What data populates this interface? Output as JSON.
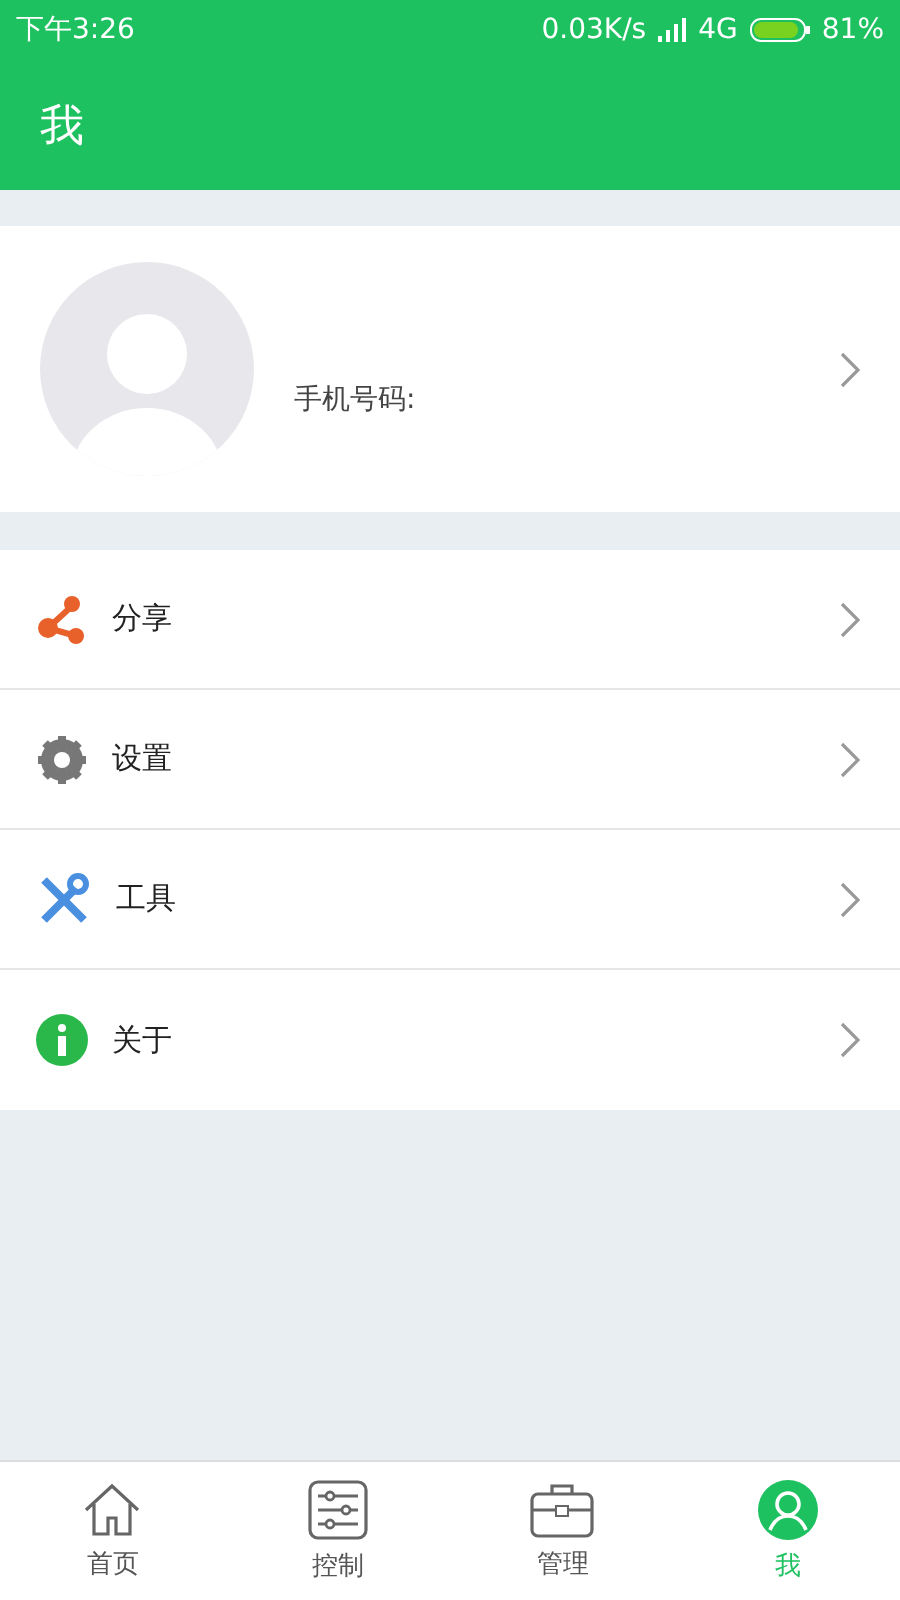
{
  "status_bar": {
    "time": "下午3:26",
    "speed": "0.03K/s",
    "network": "4G",
    "battery": "81%"
  },
  "header": {
    "title": "我"
  },
  "profile": {
    "phone_label": "手机号码:"
  },
  "menu": [
    {
      "kind": "share",
      "label": "分享"
    },
    {
      "kind": "settings",
      "label": "设置"
    },
    {
      "kind": "tools",
      "label": "工具"
    },
    {
      "kind": "about",
      "label": "关于"
    }
  ],
  "tabs": [
    {
      "kind": "home",
      "label": "首页",
      "selected": false
    },
    {
      "kind": "control",
      "label": "控制",
      "selected": false
    },
    {
      "kind": "manage",
      "label": "管理",
      "selected": false
    },
    {
      "kind": "me",
      "label": "我",
      "selected": true
    }
  ]
}
